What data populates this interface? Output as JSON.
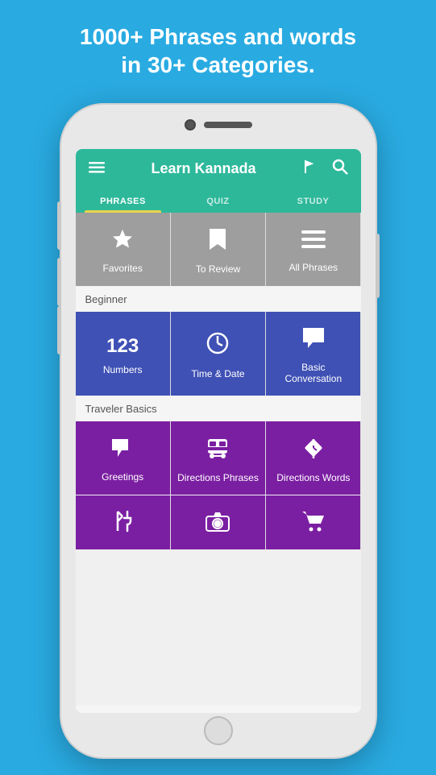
{
  "header": {
    "top_text_line1": "1000+ Phrases and words",
    "top_text_line2": "in 30+ Categories.",
    "app_title": "Learn Kannada"
  },
  "tabs": [
    {
      "id": "phrases",
      "label": "PHRASES",
      "active": true
    },
    {
      "id": "quiz",
      "label": "QUIZ",
      "active": false
    },
    {
      "id": "study",
      "label": "STUDY",
      "active": false
    }
  ],
  "top_grid": [
    {
      "id": "favorites",
      "label": "Favorites",
      "icon": "star"
    },
    {
      "id": "to-review",
      "label": "To Review",
      "icon": "bookmark"
    },
    {
      "id": "all-phrases",
      "label": "All Phrases",
      "icon": "menu"
    }
  ],
  "sections": [
    {
      "id": "beginner",
      "header": "Beginner",
      "items": [
        {
          "id": "numbers",
          "label": "Numbers",
          "icon": "123"
        },
        {
          "id": "time-date",
          "label": "Time & Date",
          "icon": "clock"
        },
        {
          "id": "basic-conversation",
          "label": "Basic Conversation",
          "icon": "chat"
        }
      ]
    },
    {
      "id": "traveler-basics",
      "header": "Traveler Basics",
      "items": [
        {
          "id": "greetings",
          "label": "Greetings",
          "icon": "speech"
        },
        {
          "id": "directions-phrases",
          "label": "Directions Phrases",
          "icon": "bus"
        },
        {
          "id": "directions-words",
          "label": "Directions Words",
          "icon": "direction-sign"
        }
      ]
    }
  ],
  "bottom_row": [
    {
      "id": "food",
      "label": "Food",
      "icon": "utensils"
    },
    {
      "id": "camera",
      "label": "Camera",
      "icon": "camera"
    },
    {
      "id": "shopping",
      "label": "Shopping",
      "icon": "cart"
    }
  ],
  "colors": {
    "background": "#29ABE2",
    "header": "#2DB89A",
    "tab_active_underline": "#E8D44D",
    "top_grid_bg": "#9E9E9E",
    "beginner_bg": "#3F51B5",
    "traveler_bg": "#7B1FA2"
  }
}
